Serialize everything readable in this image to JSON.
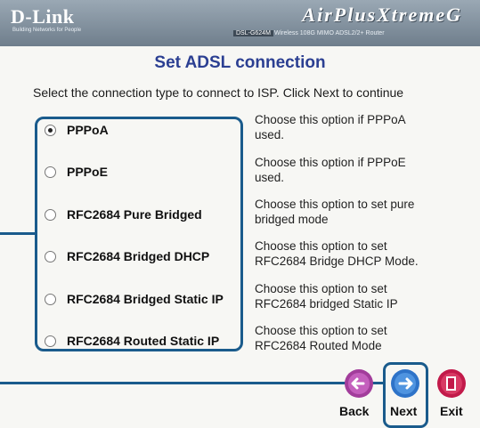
{
  "header": {
    "brand": "D-Link",
    "tagline": "Building Networks for People",
    "product": "AirPlusXtremeG",
    "model_tag": "DSL-G624M",
    "model_desc": "Wireless 108G MIMO ADSL2/2+ Router"
  },
  "page": {
    "title": "Set ADSL connection",
    "subtitle": "Select the connection type to connect to ISP. Click Next to continue"
  },
  "options": [
    {
      "label": "PPPoA",
      "desc_line1": "Choose this option if PPPoA",
      "desc_line2": "used.",
      "selected": true
    },
    {
      "label": "PPPoE",
      "desc_line1": "Choose this option if PPPoE",
      "desc_line2": "used.",
      "selected": false
    },
    {
      "label": "RFC2684 Pure Bridged",
      "desc_line1": "Choose this option to set pure",
      "desc_line2": "bridged mode",
      "selected": false
    },
    {
      "label": "RFC2684 Bridged DHCP",
      "desc_line1": "Choose this option to set",
      "desc_line2": "RFC2684 Bridge DHCP Mode.",
      "selected": false
    },
    {
      "label": "RFC2684 Bridged Static IP",
      "desc_line1": "Choose this option to set",
      "desc_line2": "RFC2684 bridged Static IP",
      "selected": false
    },
    {
      "label": "RFC2684 Routed Static IP",
      "desc_line1": "Choose this option to set",
      "desc_line2": "RFC2684 Routed Mode",
      "selected": false
    }
  ],
  "nav": {
    "back_label": "Back",
    "next_label": "Next",
    "exit_label": "Exit"
  },
  "colors": {
    "title": "#2b3f92",
    "highlight": "#1a5b8c",
    "back_button": "#a23d9b",
    "next_button": "#2e73c8",
    "exit_button": "#c21a4a"
  },
  "icons": {
    "back": "left-arrow-icon",
    "next": "right-arrow-icon",
    "exit": "exit-door-icon"
  }
}
